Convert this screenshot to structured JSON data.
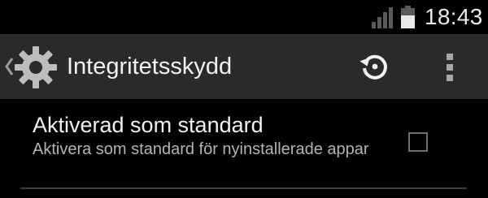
{
  "status_bar": {
    "time": "18:43",
    "signal_icon": "cell-signal-icon",
    "battery_icon": "battery-icon"
  },
  "action_bar": {
    "title": "Integritetsskydd",
    "up_icon": "back-caret-icon",
    "app_icon": "gear-icon",
    "restore_icon": "restore-icon",
    "overflow_icon": "overflow-menu-icon"
  },
  "preference": {
    "title": "Aktiverad som standard",
    "summary": "Aktivera som standard för nyinstallerade appar",
    "checked": false
  },
  "colors": {
    "background": "#000000",
    "action_bar": "#2a2a2a",
    "text_primary": "#f0f0f0",
    "text_secondary": "#b4b4b4",
    "icon_gray": "#a8a8a8"
  }
}
